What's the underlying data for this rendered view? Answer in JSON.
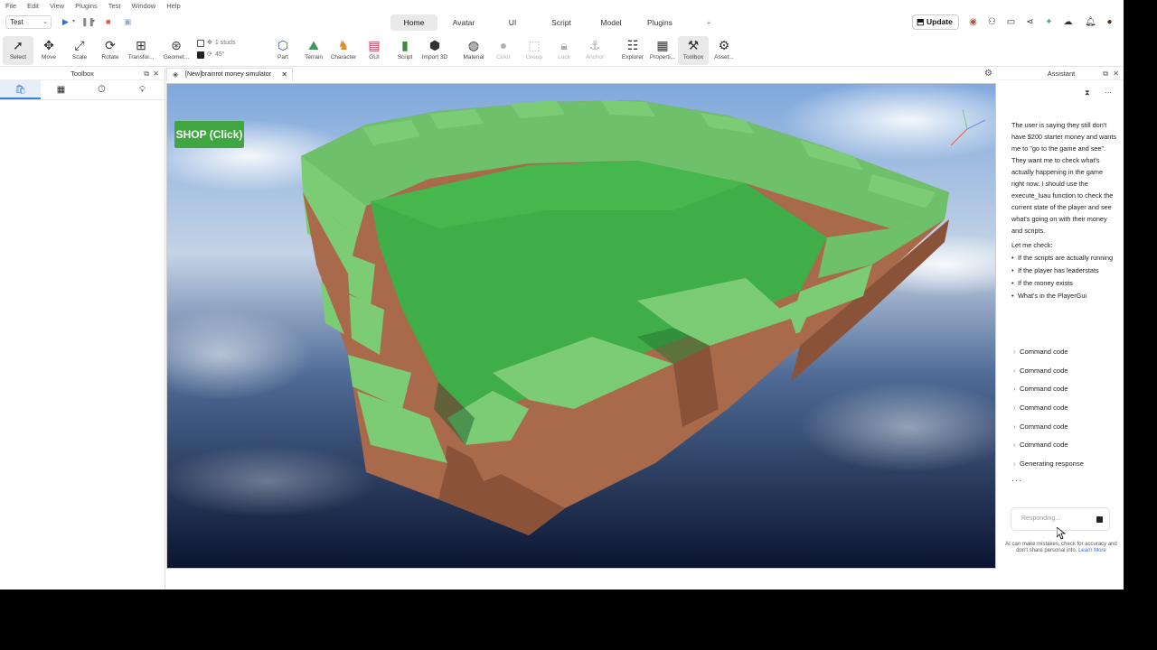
{
  "menu": [
    "File",
    "Edit",
    "View",
    "Plugins",
    "Test",
    "Window",
    "Help"
  ],
  "topbar": {
    "mode": "Test",
    "tabs": [
      {
        "label": "Home",
        "active": true
      },
      {
        "label": "Avatar",
        "active": false
      },
      {
        "label": "UI",
        "active": false
      },
      {
        "label": "Script",
        "active": false
      },
      {
        "label": "Model",
        "active": false
      },
      {
        "label": "Plugins",
        "active": false
      },
      {
        "label": "+",
        "active": false
      }
    ],
    "update_label": "Update"
  },
  "ribbon": {
    "tools": [
      {
        "label": "Select",
        "icon": "cursor-icon"
      },
      {
        "label": "Move",
        "icon": "move-icon"
      },
      {
        "label": "Scale",
        "icon": "scale-icon"
      },
      {
        "label": "Rotate",
        "icon": "rotate-icon"
      },
      {
        "label": "Transfor...",
        "icon": "transform-icon"
      },
      {
        "label": "Geomet...",
        "icon": "geometry-icon"
      },
      {
        "label": "Part",
        "icon": "part-icon"
      },
      {
        "label": "Terrain",
        "icon": "terrain-icon"
      },
      {
        "label": "Character",
        "icon": "character-icon"
      },
      {
        "label": "GUI",
        "icon": "gui-icon"
      },
      {
        "label": "Script",
        "icon": "script-icon"
      },
      {
        "label": "Import 3D",
        "icon": "import-icon"
      },
      {
        "label": "Material",
        "icon": "material-icon"
      },
      {
        "label": "Color",
        "icon": "color-icon"
      },
      {
        "label": "Group",
        "icon": "group-icon"
      },
      {
        "label": "Lock",
        "icon": "lock-icon"
      },
      {
        "label": "Anchor",
        "icon": "anchor-icon"
      },
      {
        "label": "Explorer",
        "icon": "explorer-icon"
      },
      {
        "label": "Properti...",
        "icon": "properties-icon"
      },
      {
        "label": "Toolbox",
        "icon": "toolbox-icon"
      },
      {
        "label": "Asset...",
        "icon": "asset-icon"
      }
    ],
    "snap_move": "1 studs",
    "snap_rotate": "45°"
  },
  "toolbox": {
    "title": "Toolbox"
  },
  "viewport": {
    "tab_title": "[New]brainrot money simulator",
    "shop_label": "SHOP (Click)"
  },
  "assistant": {
    "title": "Assistant",
    "message": "The user is saying they still don't have $200 starter money and wants me to \"go to the game and see\". They want me to check what's actually happening in the game right now. I should use the execute_luau function to check the current state of the player and see what's going on with their money and scripts.",
    "lead": "Let me check:",
    "bullets": [
      "If the scripts are actually running",
      "If the player has leaderstats",
      "If the money exists",
      "What's in the PlayerGui"
    ],
    "commands": [
      "Command code",
      "Command code",
      "Command code",
      "Command code",
      "Command code",
      "Command code",
      "Generating response"
    ],
    "input_placeholder": "Responding...",
    "disclaimer": "AI can make mistakes, check for accuracy and don't share personal info.",
    "learn_more": "Learn More"
  }
}
